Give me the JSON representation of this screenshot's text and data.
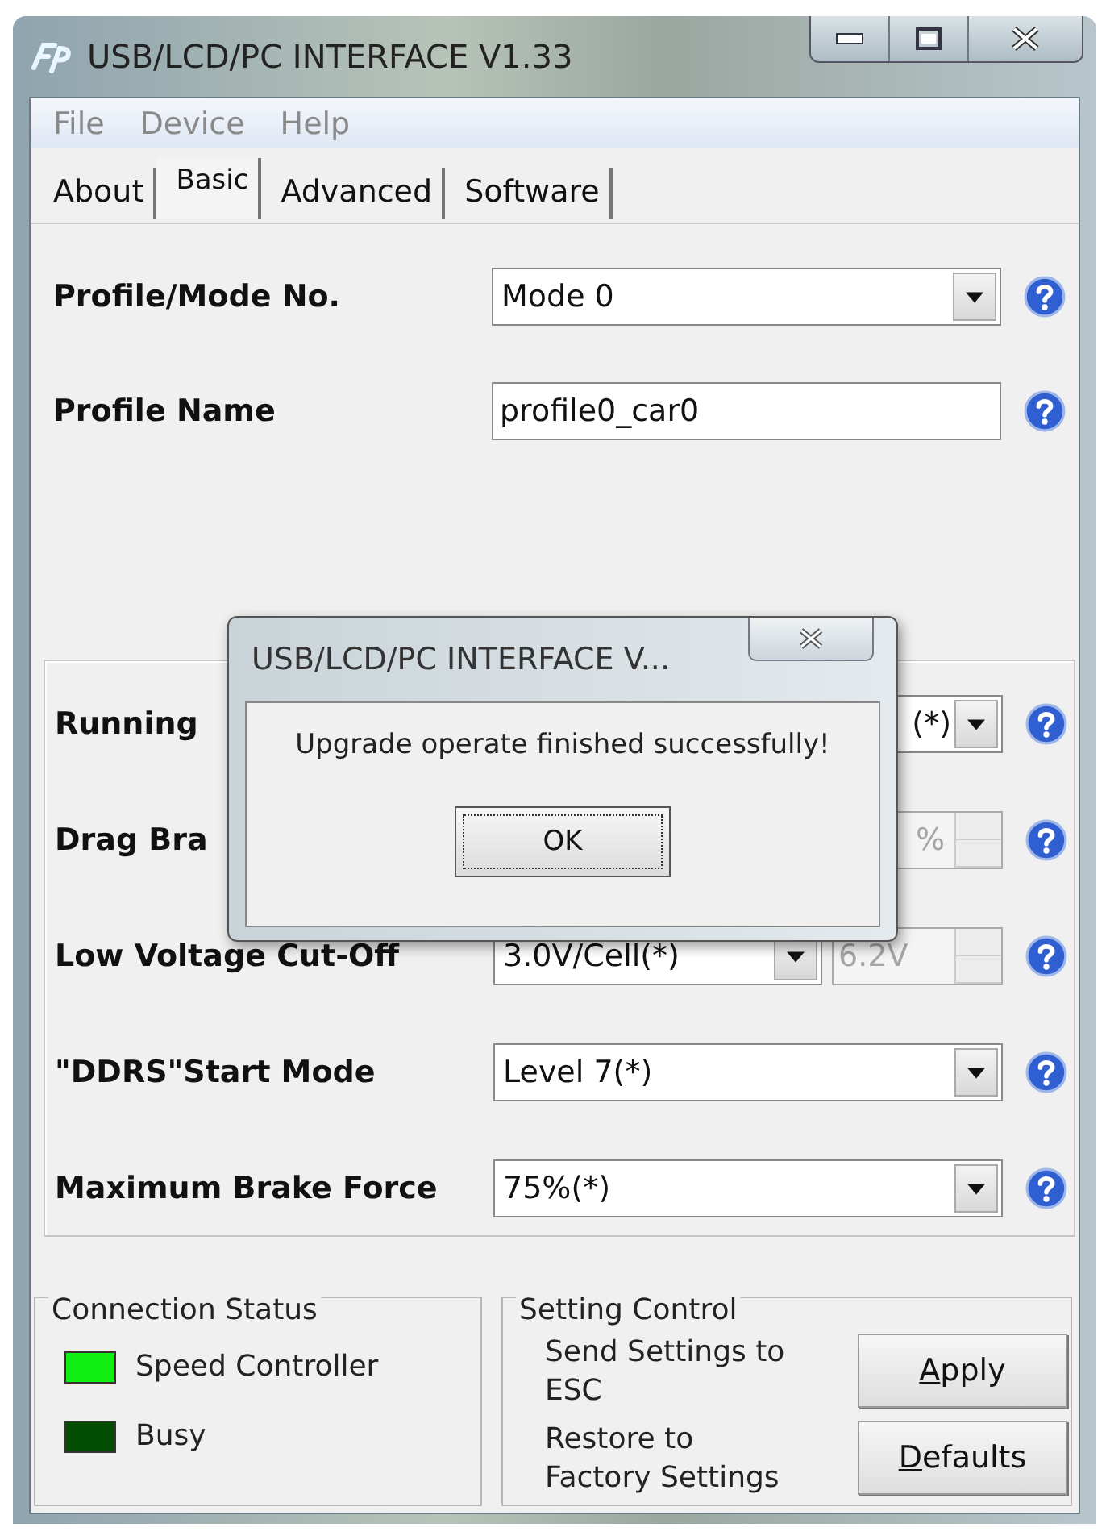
{
  "window": {
    "title": "USB/LCD/PC INTERFACE V1.33"
  },
  "menu": [
    "File",
    "Device",
    "Help"
  ],
  "tabs": [
    {
      "label": "About",
      "selected": false
    },
    {
      "label": "Basic",
      "selected": true
    },
    {
      "label": "Advanced",
      "selected": false
    },
    {
      "label": "Software",
      "selected": false
    }
  ],
  "top_rows": [
    {
      "label": "Profile/Mode No.",
      "kind": "combo",
      "value": "Mode 0",
      "covered": false
    },
    {
      "label": "Profile Name",
      "kind": "text",
      "value": "profile0_car0"
    }
  ],
  "settings_rows": [
    {
      "label": "Running",
      "kind": "combo",
      "value": "(*)",
      "covered": true
    },
    {
      "label": "Drag Bra",
      "kind": "spin-only",
      "covered": true,
      "spin_value": "%",
      "spin_disabled": true
    },
    {
      "label": "Low Voltage Cut-Off",
      "kind": "combo-spin",
      "value": "3.0V/Cell(*)",
      "covered": false,
      "spin_value": "6.2V",
      "spin_disabled": true
    },
    {
      "label": "\"DDRS\"Start Mode",
      "kind": "combo",
      "value": "Level 7(*)",
      "covered": false
    },
    {
      "label": "Maximum Brake Force",
      "kind": "combo",
      "value": "75%(*)",
      "covered": false
    }
  ],
  "dialog": {
    "title": "USB/LCD/PC INTERFACE V...",
    "message": "Upgrade operate finished successfully!",
    "button": "OK"
  },
  "connection_status": {
    "title": "Connection Status",
    "indicators": [
      {
        "label": "Speed Controller",
        "color": "#11ee11"
      },
      {
        "label": "Busy",
        "color": "#034d03"
      }
    ]
  },
  "setting_control": {
    "title": "Setting Control",
    "descriptions": [
      "Send Settings to ESC",
      "Restore to Factory Settings"
    ],
    "buttons": [
      {
        "label": "Apply",
        "underline_first": true
      },
      {
        "label": "Defaults",
        "underline_first": true
      }
    ]
  }
}
